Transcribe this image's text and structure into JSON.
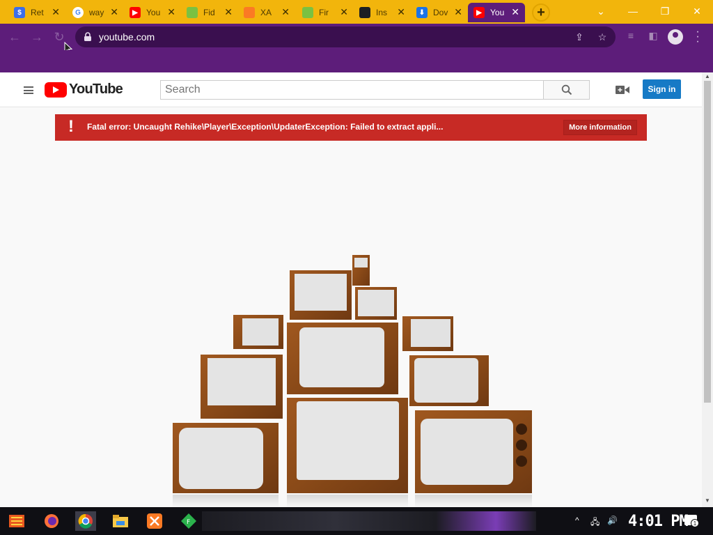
{
  "browser": {
    "tabs": [
      {
        "title": "Ret",
        "favicon": "rehike-icon",
        "color": "#3d6ee8",
        "glyph": "$",
        "active": false
      },
      {
        "title": "way",
        "favicon": "google-icon",
        "color": "#ffffff",
        "glyph": "G",
        "active": false
      },
      {
        "title": "You",
        "favicon": "youtube-icon",
        "color": "#ff0000",
        "glyph": "▶",
        "active": false
      },
      {
        "title": "Fid",
        "favicon": "fiddler-icon",
        "color": "#7ac142",
        "glyph": "",
        "active": false
      },
      {
        "title": "XA",
        "favicon": "xampp-icon",
        "color": "#fb7a24",
        "glyph": "",
        "active": false
      },
      {
        "title": "Fir",
        "favicon": "fiddler-icon",
        "color": "#7ac142",
        "glyph": "",
        "active": false
      },
      {
        "title": "Ins",
        "favicon": "github-icon",
        "color": "#1b1f23",
        "glyph": "",
        "active": false
      },
      {
        "title": "Dov",
        "favicon": "download-icon",
        "color": "#1a73e8",
        "glyph": "⬇",
        "active": false
      },
      {
        "title": "You",
        "favicon": "youtube-icon",
        "color": "#ff0000",
        "glyph": "▶",
        "active": true
      }
    ],
    "new_tab": "+",
    "url": "youtube.com",
    "accent": "#5d1d7a",
    "tab_strip_color": "#f2b50c"
  },
  "youtube": {
    "logo_text": "YouTube",
    "search_placeholder": "Search",
    "signin_label": "Sign in",
    "error": {
      "icon": "!",
      "message": "Fatal error: Uncaught Rehike\\Player\\Exception\\UpdaterException: Failed to extract appli...",
      "more_label": "More information",
      "color": "#c72a25"
    }
  },
  "taskbar": {
    "clock": "4:01 PM",
    "notification_count": "1"
  }
}
